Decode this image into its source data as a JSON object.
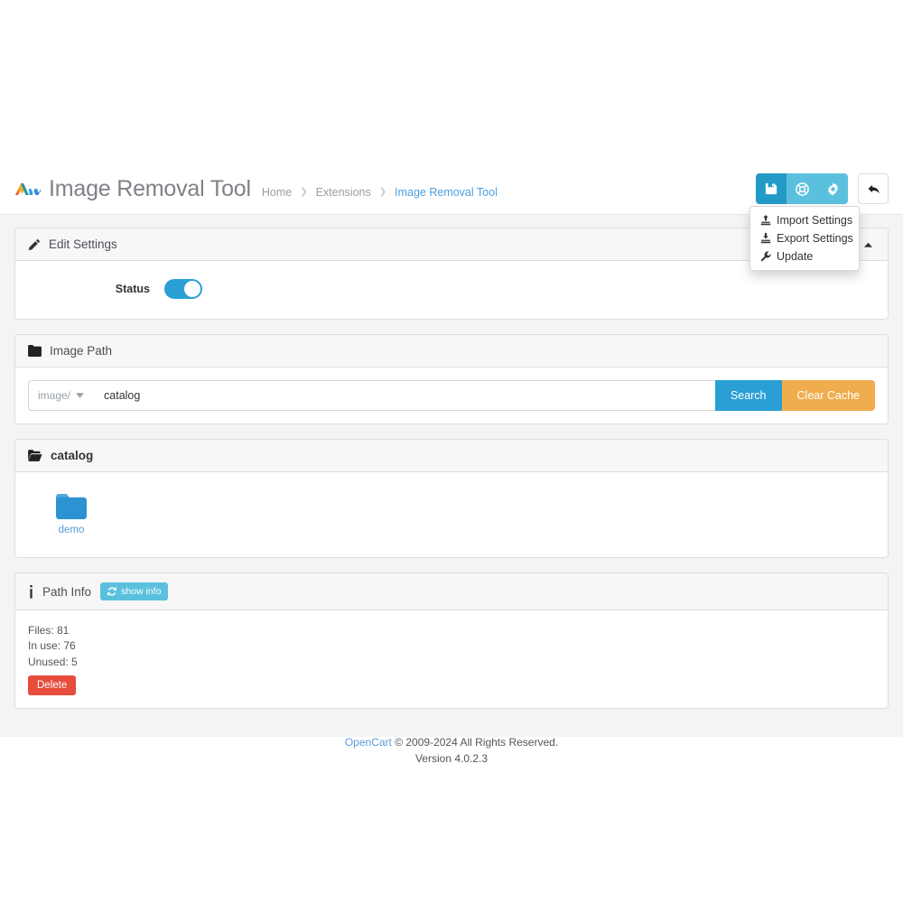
{
  "header": {
    "title": "Image Removal Tool",
    "logo_icon": "opencart-logo-icon",
    "breadcrumb": [
      {
        "label": "Home",
        "active": false
      },
      {
        "label": "Extensions",
        "active": false
      },
      {
        "label": "Image Removal Tool",
        "active": true
      }
    ],
    "actions": {
      "save": {
        "icon": "floppy-save-icon",
        "title": "Save"
      },
      "support": {
        "icon": "life-ring-icon",
        "title": "Support"
      },
      "settings": {
        "icon": "gear-icon",
        "title": "Settings"
      },
      "back": {
        "icon": "reply-back-icon",
        "title": "Back"
      }
    },
    "dropdown": {
      "open": true,
      "items": [
        {
          "label": "Import Settings",
          "icon": "upload-icon"
        },
        {
          "label": "Export Settings",
          "icon": "download-icon"
        },
        {
          "label": "Update",
          "icon": "wrench-icon"
        }
      ]
    }
  },
  "edit_settings": {
    "title": "Edit Settings",
    "icon": "pencil-icon",
    "collapse_icon": "caret-up-icon",
    "status_label": "Status",
    "status_on": true
  },
  "image_path": {
    "title": "Image Path",
    "icon": "folder-icon",
    "prefix_label": "image/",
    "prefix_caret": "caret-down-icon",
    "input_value": "catalog",
    "input_placeholder": "",
    "search_label": "Search",
    "clear_cache_label": "Clear Cache"
  },
  "directory": {
    "title": "catalog",
    "icon": "folder-open-icon",
    "items": [
      {
        "label": "demo",
        "icon": "folder-blue-icon"
      }
    ]
  },
  "path_info": {
    "title": "Path Info",
    "icon": "info-icon",
    "show_info_label": "show info",
    "show_info_icon": "refresh-icon",
    "files_line": "Files: 81",
    "in_use_line": "In use: 76",
    "unused_line": "Unused: 5",
    "delete_label": "Delete"
  },
  "footer": {
    "link_label": "OpenCart",
    "copyright": " © 2009-2024 All Rights Reserved.",
    "version": "Version 4.0.2.3"
  },
  "colors": {
    "primary": "#229ac8",
    "info": "#5bc0de",
    "warning": "#f0ad4e",
    "danger": "#e74c3c",
    "link": "#5b9bd5",
    "page_bg": "#f4f4f4"
  }
}
